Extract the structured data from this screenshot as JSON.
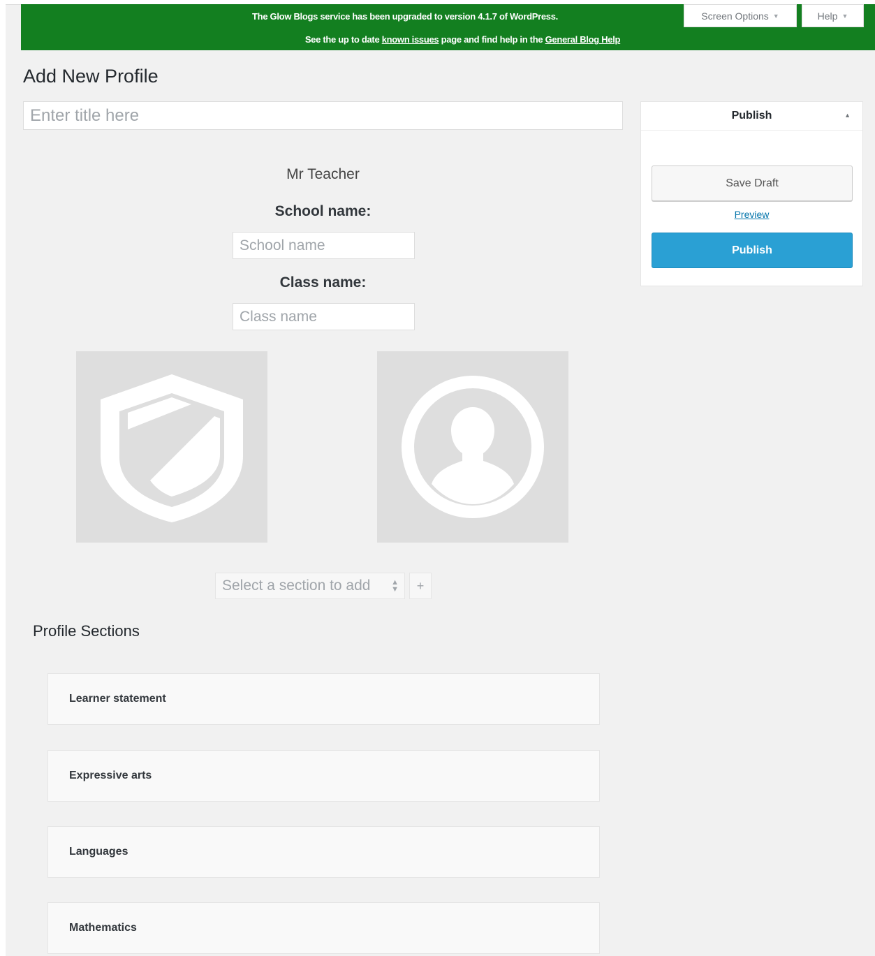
{
  "colors": {
    "notice_bg": "#137f20",
    "publish_button": "#2aa0d4",
    "link": "#0073aa",
    "placeholder_bg": "#dedede"
  },
  "notice": {
    "line1": "The Glow Blogs service has been upgraded to version 4.1.7 of WordPress.",
    "line2_prefix": "See the up to date ",
    "known_issues_link": "known issues",
    "line2_middle": " page and find help in the ",
    "general_help_link": "General Blog Help"
  },
  "top_tabs": {
    "screen_options": "Screen Options",
    "help": "Help"
  },
  "page_title": "Add New Profile",
  "title_input": {
    "placeholder": "Enter title here",
    "value": ""
  },
  "profile": {
    "teacher_name": "Mr Teacher",
    "school_label": "School name:",
    "school_placeholder": "School name",
    "class_label": "Class name:",
    "class_placeholder": "Class name",
    "school_logo_icon": "shield-icon",
    "profile_photo_icon": "user-avatar-icon"
  },
  "section_picker": {
    "selected": "Select a section to add",
    "add_label": "+"
  },
  "sections": {
    "heading": "Profile Sections",
    "items": [
      {
        "label": "Learner statement"
      },
      {
        "label": "Expressive arts"
      },
      {
        "label": "Languages"
      },
      {
        "label": "Mathematics"
      }
    ]
  },
  "publish_box": {
    "title": "Publish",
    "save_draft": "Save Draft",
    "preview": "Preview",
    "publish": "Publish"
  }
}
